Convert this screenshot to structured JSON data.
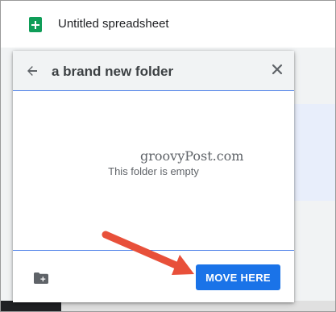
{
  "topbar": {
    "app_icon": "google-sheets-icon",
    "doc_title": "Untitled spreadsheet"
  },
  "dialog": {
    "back_icon": "arrow-left-icon",
    "title": "a brand new folder",
    "close_icon": "close-icon",
    "watermark": "groovyPost.com",
    "empty_message": "This folder is empty",
    "new_folder_icon": "create-new-folder-icon",
    "move_button_label": "MOVE HERE"
  },
  "annotation": {
    "arrow_icon": "red-arrow-pointer",
    "arrow_color": "#e8503a"
  },
  "colors": {
    "accent": "#1a73e8",
    "sheets_green": "#0f9d58"
  }
}
